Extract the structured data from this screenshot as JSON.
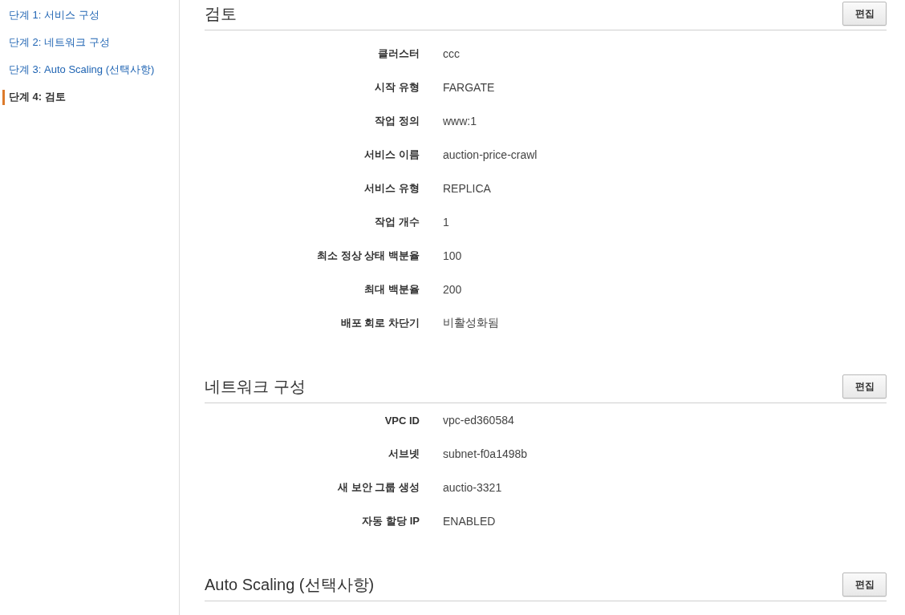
{
  "sidebar": {
    "steps": [
      {
        "label": "단계 1: 서비스 구성",
        "selected": false
      },
      {
        "label": "단계 2: 네트워크 구성",
        "selected": false
      },
      {
        "label": "단계 3: Auto Scaling (선택사항)",
        "selected": false
      },
      {
        "label": "단계 4: 검토",
        "selected": true
      }
    ]
  },
  "sections": [
    {
      "title": "검토",
      "edit_button": "편집",
      "fields": [
        {
          "label": "클러스터",
          "value": "ccc"
        },
        {
          "label": "시작 유형",
          "value": "FARGATE"
        },
        {
          "label": "작업 정의",
          "value": "www:1"
        },
        {
          "label": "서비스 이름",
          "value": "auction-price-crawl"
        },
        {
          "label": "서비스 유형",
          "value": "REPLICA"
        },
        {
          "label": "작업 개수",
          "value": "1"
        },
        {
          "label": "최소 정상 상태 백분율",
          "value": "100"
        },
        {
          "label": "최대 백분율",
          "value": "200"
        },
        {
          "label": "배포 회로 차단기",
          "value": "비활성화됨"
        }
      ]
    },
    {
      "title": "네트워크 구성",
      "edit_button": "편집",
      "fields": [
        {
          "label": "VPC ID",
          "value": "vpc-ed360584"
        },
        {
          "label": "서브넷",
          "value": "subnet-f0a1498b"
        },
        {
          "label": "새 보안 그룹 생성",
          "value": "auctio-3321"
        },
        {
          "label": "자동 할당 IP",
          "value": "ENABLED"
        }
      ]
    },
    {
      "title": "Auto Scaling (선택사항)",
      "edit_button": "편집"
    }
  ]
}
